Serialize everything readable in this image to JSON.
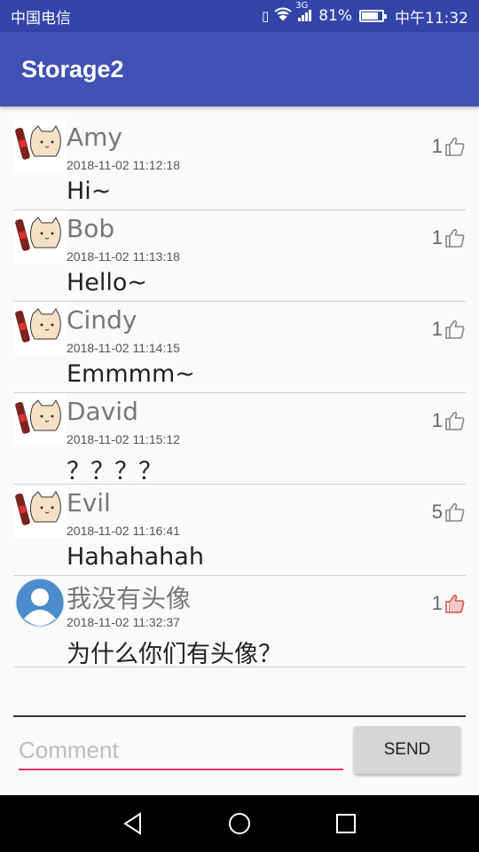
{
  "status_bar": {
    "carrier": "中国电信",
    "signal_label": "3G",
    "battery": "81%",
    "time": "中午11:32"
  },
  "app_bar": {
    "title": "Storage2"
  },
  "comments": [
    {
      "name": "Amy",
      "time": "2018-11-02 11:12:18",
      "content": "Hi~",
      "likes": "1",
      "liked": false,
      "avatar": "cat-bottle-avatar"
    },
    {
      "name": "Bob",
      "time": "2018-11-02 11:13:18",
      "content": "Hello~",
      "likes": "1",
      "liked": false,
      "avatar": "cat-bottle-avatar"
    },
    {
      "name": "Cindy",
      "time": "2018-11-02 11:14:15",
      "content": "Emmmm~",
      "likes": "1",
      "liked": false,
      "avatar": "cat-bottle-avatar"
    },
    {
      "name": "David",
      "time": "2018-11-02 11:15:12",
      "content": "？？？？",
      "likes": "1",
      "liked": false,
      "avatar": "cat-bottle-avatar"
    },
    {
      "name": "Evil",
      "time": "2018-11-02 11:16:41",
      "content": "Hahahahah",
      "likes": "5",
      "liked": false,
      "avatar": "cat-bottle-avatar"
    },
    {
      "name": "我没有头像",
      "time": "2018-11-02 11:32:37",
      "content": "为什么你们有头像？",
      "likes": "1",
      "liked": true,
      "avatar": "default-user-avatar"
    }
  ],
  "input": {
    "placeholder": "Comment",
    "value": ""
  },
  "send_label": "SEND",
  "colors": {
    "status_bar": "#3344a8",
    "app_bar": "#3f51b5",
    "accent": "#e0336e",
    "like_active": "#d9534f",
    "like_inactive": "#888888"
  }
}
